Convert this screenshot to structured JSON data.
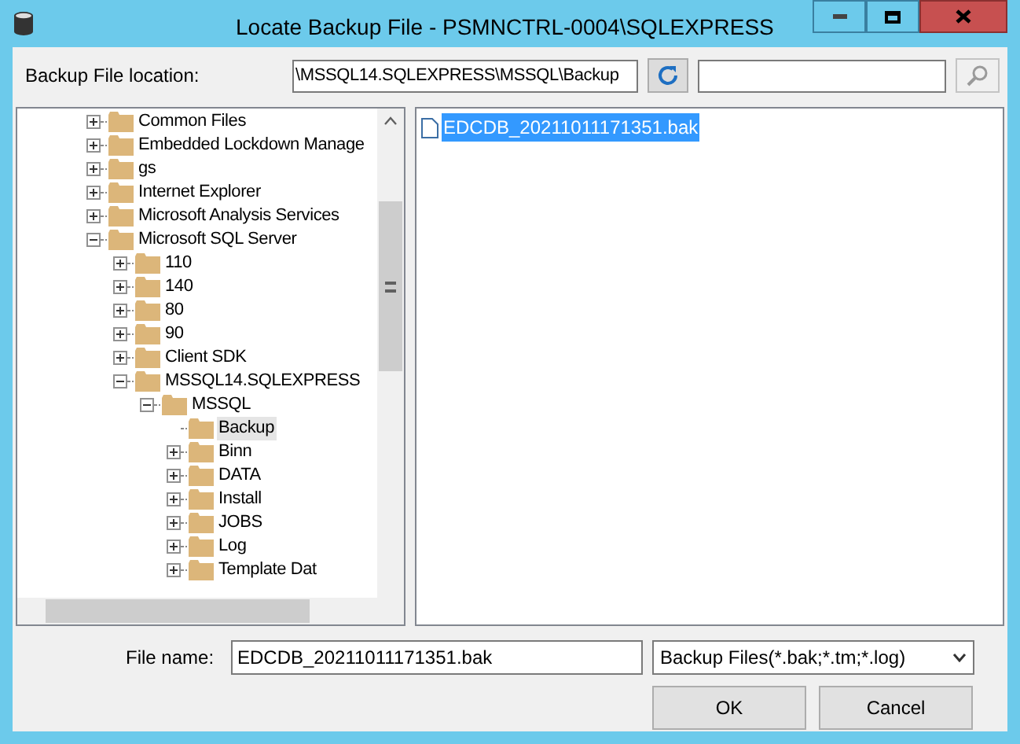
{
  "window": {
    "title": "Locate Backup File - PSMNCTRL-0004\\SQLEXPRESS"
  },
  "location": {
    "label": "Backup File location:",
    "value": "\\MSSQL14.SQLEXPRESS\\MSSQL\\Backup"
  },
  "tree": [
    {
      "label": "Common Files",
      "kind": "branch",
      "expanded": false,
      "selected": false
    },
    {
      "label": "Embedded Lockdown Manage",
      "kind": "branch",
      "expanded": false,
      "selected": false
    },
    {
      "label": "gs",
      "kind": "branch",
      "expanded": false,
      "selected": false
    },
    {
      "label": "Internet Explorer",
      "kind": "branch",
      "expanded": false,
      "selected": false
    },
    {
      "label": "Microsoft Analysis Services",
      "kind": "branch",
      "expanded": false,
      "selected": false
    },
    {
      "label": "Microsoft SQL Server",
      "kind": "branch",
      "expanded": true,
      "selected": false,
      "children": [
        {
          "label": "110",
          "kind": "branch",
          "expanded": false,
          "selected": false
        },
        {
          "label": "140",
          "kind": "branch",
          "expanded": false,
          "selected": false
        },
        {
          "label": "80",
          "kind": "branch",
          "expanded": false,
          "selected": false
        },
        {
          "label": "90",
          "kind": "branch",
          "expanded": false,
          "selected": false
        },
        {
          "label": "Client SDK",
          "kind": "branch",
          "expanded": false,
          "selected": false
        },
        {
          "label": "MSSQL14.SQLEXPRESS",
          "kind": "branch",
          "expanded": true,
          "selected": false,
          "children": [
            {
              "label": "MSSQL",
              "kind": "branch",
              "expanded": true,
              "selected": false,
              "children": [
                {
                  "label": "Backup",
                  "kind": "leaf",
                  "selected": true
                },
                {
                  "label": "Binn",
                  "kind": "branch",
                  "expanded": false,
                  "selected": false
                },
                {
                  "label": "DATA",
                  "kind": "branch",
                  "expanded": false,
                  "selected": false
                },
                {
                  "label": "Install",
                  "kind": "branch",
                  "expanded": false,
                  "selected": false
                },
                {
                  "label": "JOBS",
                  "kind": "branch",
                  "expanded": false,
                  "selected": false
                },
                {
                  "label": "Log",
                  "kind": "branch",
                  "expanded": false,
                  "selected": false
                },
                {
                  "label": "Template Dat",
                  "kind": "branch",
                  "expanded": false,
                  "selected": false
                }
              ]
            }
          ]
        }
      ]
    }
  ],
  "files": [
    {
      "name": "EDCDB_20211011171351.bak",
      "selected": true
    }
  ],
  "file_name": {
    "label": "File name:",
    "value": "EDCDB_20211011171351.bak"
  },
  "file_type": {
    "value": "Backup Files(*.bak;*.tm;*.log)"
  },
  "buttons": [
    "OK",
    "Cancel"
  ]
}
